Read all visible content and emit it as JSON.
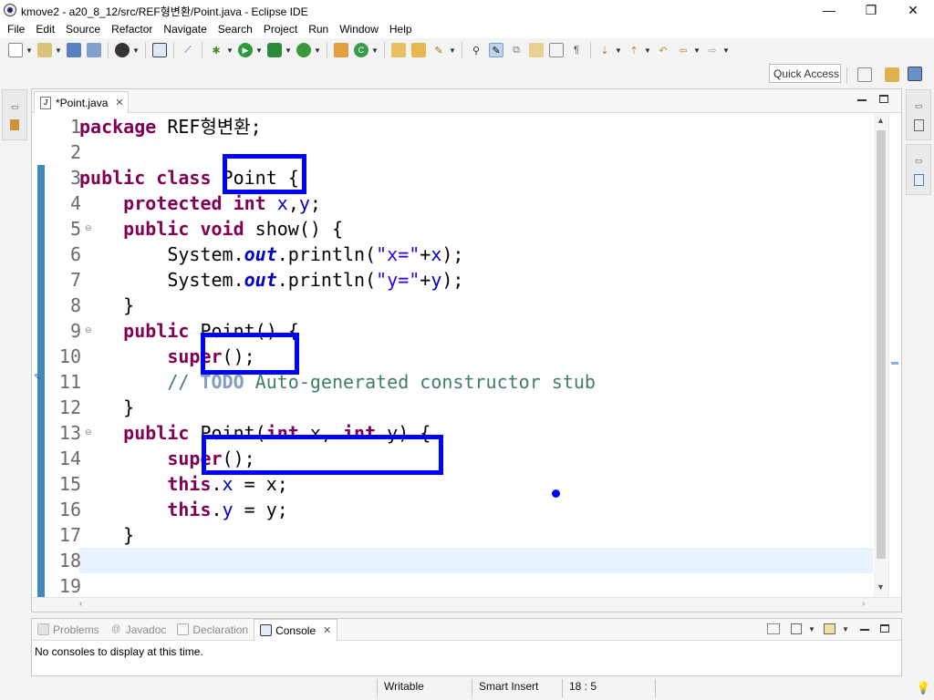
{
  "window": {
    "title": "kmove2 - a20_8_12/src/REF형변환/Point.java - Eclipse IDE",
    "minimize_glyph": "—",
    "maximize_glyph": "❐",
    "close_glyph": "✕"
  },
  "menubar": {
    "items": [
      "File",
      "Edit",
      "Source",
      "Refactor",
      "Navigate",
      "Search",
      "Project",
      "Run",
      "Window",
      "Help"
    ]
  },
  "toolbar": {
    "quick_access_label": "Quick Access"
  },
  "editor": {
    "tab_title": "*Point.java",
    "tab_icon": "java-file-icon",
    "tab_close_glyph": "✕",
    "line_numbers": [
      "1",
      "2",
      "3",
      "4",
      "5",
      "6",
      "7",
      "8",
      "9",
      "10",
      "11",
      "12",
      "13",
      "14",
      "15",
      "16",
      "17",
      "18",
      "19"
    ],
    "current_line": 18
  },
  "code_lines": [
    [
      {
        "t": "package",
        "c": "kw"
      },
      {
        "t": " REF형변환;",
        "c": ""
      }
    ],
    [],
    [
      {
        "t": "public",
        "c": "kw"
      },
      {
        "t": " ",
        "c": ""
      },
      {
        "t": "class",
        "c": "kw"
      },
      {
        "t": " Point {",
        "c": ""
      }
    ],
    [
      {
        "t": "    ",
        "c": ""
      },
      {
        "t": "protected",
        "c": "kw"
      },
      {
        "t": " ",
        "c": ""
      },
      {
        "t": "int",
        "c": "kw"
      },
      {
        "t": " ",
        "c": ""
      },
      {
        "t": "x",
        "c": "fld"
      },
      {
        "t": ",",
        "c": ""
      },
      {
        "t": "y",
        "c": "fld"
      },
      {
        "t": ";",
        "c": ""
      }
    ],
    [
      {
        "t": "    ",
        "c": ""
      },
      {
        "t": "public",
        "c": "kw"
      },
      {
        "t": " ",
        "c": ""
      },
      {
        "t": "void",
        "c": "kw"
      },
      {
        "t": " show() {",
        "c": ""
      }
    ],
    [
      {
        "t": "        System.",
        "c": ""
      },
      {
        "t": "out",
        "c": "sfld"
      },
      {
        "t": ".println(",
        "c": ""
      },
      {
        "t": "\"x=\"",
        "c": "str"
      },
      {
        "t": "+",
        "c": ""
      },
      {
        "t": "x",
        "c": "fld"
      },
      {
        "t": ");",
        "c": ""
      }
    ],
    [
      {
        "t": "        System.",
        "c": ""
      },
      {
        "t": "out",
        "c": "sfld"
      },
      {
        "t": ".println(",
        "c": ""
      },
      {
        "t": "\"y=\"",
        "c": "str"
      },
      {
        "t": "+",
        "c": ""
      },
      {
        "t": "y",
        "c": "fld"
      },
      {
        "t": ");",
        "c": ""
      }
    ],
    [
      {
        "t": "    }",
        "c": ""
      }
    ],
    [
      {
        "t": "    ",
        "c": ""
      },
      {
        "t": "public",
        "c": "kw"
      },
      {
        "t": " Point() {",
        "c": ""
      }
    ],
    [
      {
        "t": "        ",
        "c": ""
      },
      {
        "t": "super",
        "c": "kw"
      },
      {
        "t": "();",
        "c": ""
      }
    ],
    [
      {
        "t": "        ",
        "c": ""
      },
      {
        "t": "// ",
        "c": "cmt"
      },
      {
        "t": "TODO",
        "c": "todo"
      },
      {
        "t": " Auto-generated constructor stub",
        "c": "cmt"
      }
    ],
    [
      {
        "t": "    }",
        "c": ""
      }
    ],
    [
      {
        "t": "    ",
        "c": ""
      },
      {
        "t": "public",
        "c": "kw"
      },
      {
        "t": " Point(",
        "c": ""
      },
      {
        "t": "int",
        "c": "kw"
      },
      {
        "t": " x, ",
        "c": ""
      },
      {
        "t": "int",
        "c": "kw"
      },
      {
        "t": " y) {",
        "c": ""
      }
    ],
    [
      {
        "t": "        ",
        "c": ""
      },
      {
        "t": "super",
        "c": "kw"
      },
      {
        "t": "();",
        "c": ""
      }
    ],
    [
      {
        "t": "        ",
        "c": ""
      },
      {
        "t": "this",
        "c": "kw"
      },
      {
        "t": ".",
        "c": ""
      },
      {
        "t": "x",
        "c": "fld"
      },
      {
        "t": " = x;",
        "c": ""
      }
    ],
    [
      {
        "t": "        ",
        "c": ""
      },
      {
        "t": "this",
        "c": "kw"
      },
      {
        "t": ".",
        "c": ""
      },
      {
        "t": "y",
        "c": "fld"
      },
      {
        "t": " = y;",
        "c": ""
      }
    ],
    [
      {
        "t": "    }",
        "c": ""
      }
    ],
    [],
    []
  ],
  "bottom_panel": {
    "tabs": [
      {
        "label": "Problems",
        "icon": "problems-icon"
      },
      {
        "label": "Javadoc",
        "icon": "javadoc-icon"
      },
      {
        "label": "Declaration",
        "icon": "declaration-icon"
      },
      {
        "label": "Console",
        "icon": "console-icon"
      }
    ],
    "active_tab": "Console",
    "close_glyph": "✕",
    "console_message": "No consoles to display at this time."
  },
  "statusbar": {
    "writable": "Writable",
    "insert_mode": "Smart Insert",
    "position": "18 : 5"
  },
  "colors": {
    "keyword": "#7f0055",
    "field": "#0000c0",
    "string": "#2a00ff",
    "comment": "#3f7f5f",
    "highlight_box": "#0000ff",
    "change_bar": "#3f87bf"
  }
}
